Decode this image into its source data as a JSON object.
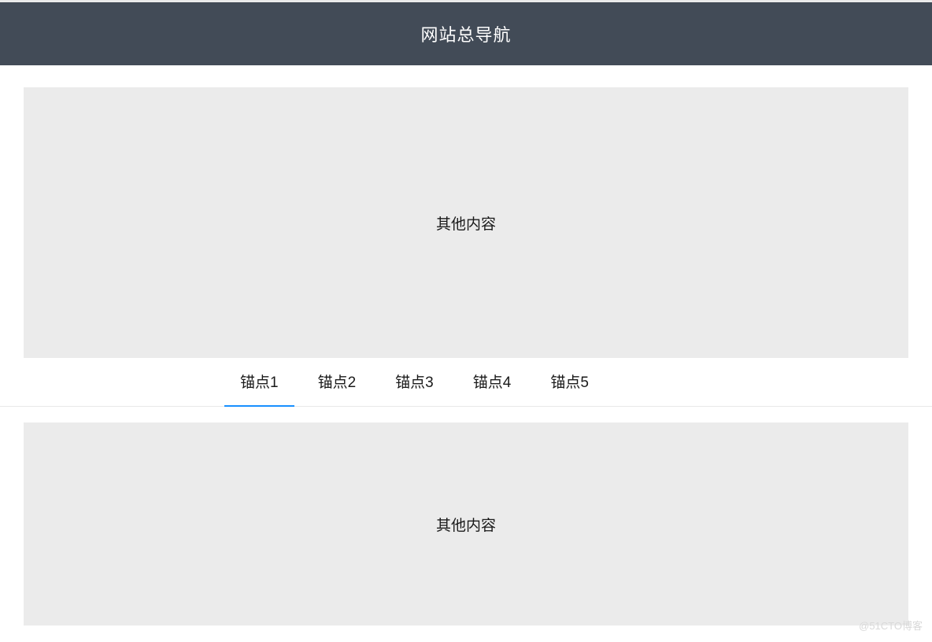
{
  "header": {
    "title": "网站总导航"
  },
  "contentBlocks": {
    "first": "其他内容",
    "second": "其他内容"
  },
  "anchors": {
    "items": [
      {
        "label": "锚点1",
        "active": true
      },
      {
        "label": "锚点2",
        "active": false
      },
      {
        "label": "锚点3",
        "active": false
      },
      {
        "label": "锚点4",
        "active": false
      },
      {
        "label": "锚点5",
        "active": false
      }
    ]
  },
  "watermark": "@51CTO博客"
}
